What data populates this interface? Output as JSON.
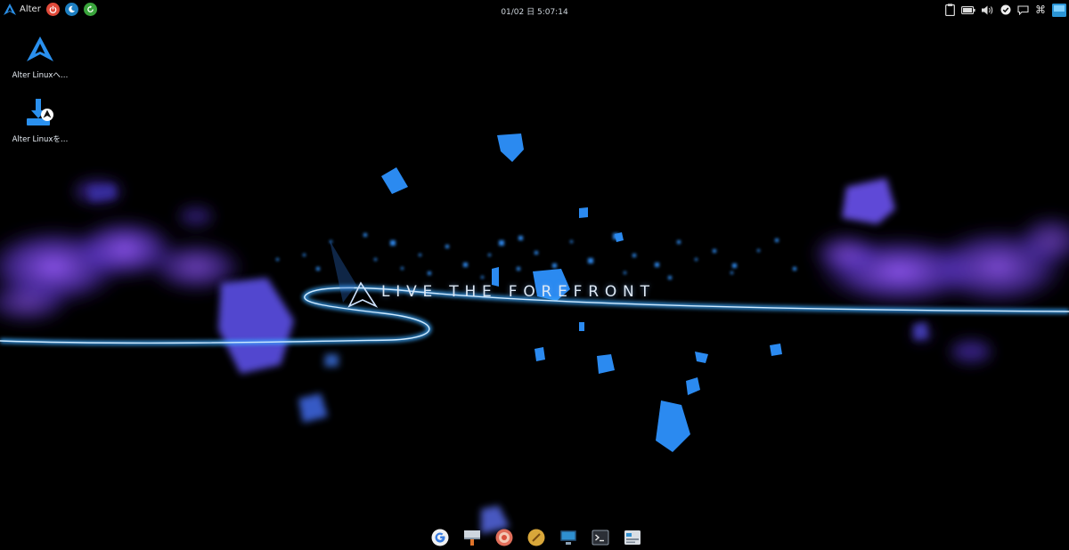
{
  "topbar": {
    "menu_label": "Alter",
    "clock_text": "01/02 日  5:07:14",
    "buttons": [
      {
        "icon": "power-icon",
        "color": "#e04a3a"
      },
      {
        "icon": "moon-icon",
        "color": "#3a9ad8"
      },
      {
        "icon": "restart-icon",
        "color": "#49b64a"
      }
    ],
    "tray": [
      "clipboard-icon",
      "battery-icon",
      "volume-icon",
      "check-circle-icon",
      "chat-icon",
      "command-icon",
      "display-icon"
    ]
  },
  "desktop": {
    "icons": [
      {
        "label": "Alter Linuxへ…",
        "icon": "alter-logo-icon"
      },
      {
        "label": "Alter Linuxを…",
        "icon": "install-icon"
      }
    ]
  },
  "wallpaper": {
    "slogan": "LIVE THE FOREFRONT"
  },
  "dock": {
    "apps": [
      "google-chrome-icon",
      "paint-icon",
      "software-center-icon",
      "pen-icon",
      "monitor-icon",
      "terminal-icon",
      "system-settings-icon"
    ]
  },
  "colors": {
    "accent": "#1e88e5",
    "background": "#000000"
  }
}
